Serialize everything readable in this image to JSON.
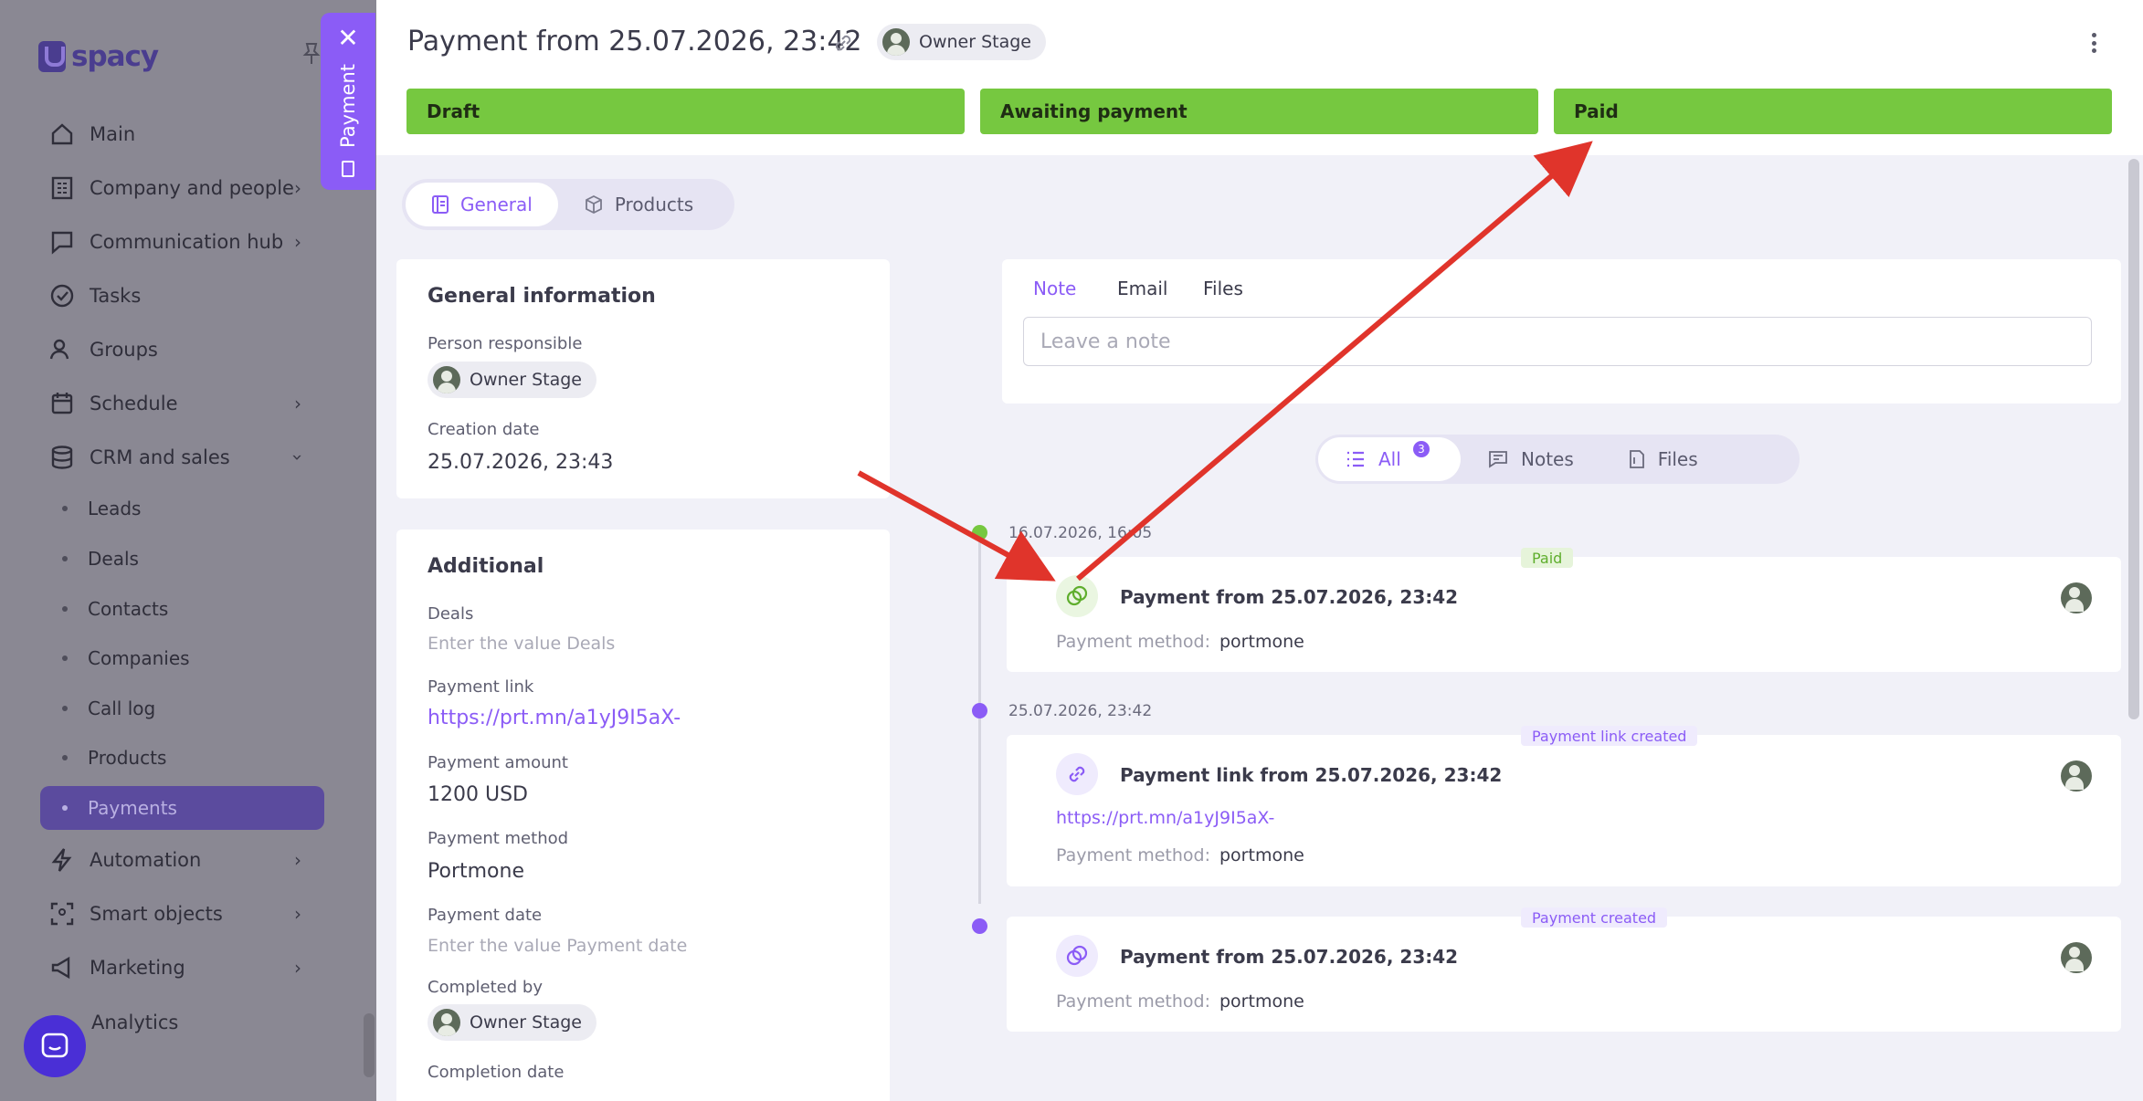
{
  "brand": {
    "name": "spacy"
  },
  "sidebar": {
    "items": [
      {
        "label": "Main",
        "icon": "home-icon"
      },
      {
        "label": "Company and people",
        "icon": "building-icon"
      },
      {
        "label": "Communication hub",
        "icon": "chat-icon"
      },
      {
        "label": "Tasks",
        "icon": "check-circle-icon"
      },
      {
        "label": "Groups",
        "icon": "users-icon"
      },
      {
        "label": "Schedule",
        "icon": "calendar-icon"
      },
      {
        "label": "CRM and sales",
        "icon": "database-icon"
      }
    ],
    "sub_items": [
      "Leads",
      "Deals",
      "Contacts",
      "Companies",
      "Call log",
      "Products",
      "Payments"
    ],
    "bottom_items": [
      {
        "label": "Automation",
        "icon": "lightning-icon"
      },
      {
        "label": "Smart objects",
        "icon": "scan-icon"
      },
      {
        "label": "Marketing",
        "icon": "megaphone-icon"
      },
      {
        "label": "Analytics",
        "icon": "chart-icon"
      }
    ]
  },
  "side_tab": {
    "label": "Payment"
  },
  "header": {
    "title": "Payment from 25.07.2026, 23:42",
    "owner": "Owner Stage",
    "stages": [
      "Draft",
      "Awaiting payment",
      "Paid"
    ],
    "stage_color": "#76c840"
  },
  "tabs": {
    "general": "General",
    "products": "Products"
  },
  "general_info": {
    "heading": "General information",
    "person_label": "Person responsible",
    "person": "Owner Stage",
    "creation_label": "Creation date",
    "creation_value": "25.07.2026, 23:43"
  },
  "additional": {
    "heading": "Additional",
    "deals_label": "Deals",
    "deals_placeholder": "Enter the value Deals",
    "link_label": "Payment link",
    "link_value": "https://prt.mn/a1yJ9I5aX-",
    "amount_label": "Payment amount",
    "amount_value": "1200 USD",
    "method_label": "Payment method",
    "method_value": "Portmone",
    "date_label": "Payment date",
    "date_placeholder": "Enter the value Payment date",
    "completed_label": "Completed by",
    "completed_value": "Owner Stage",
    "completion_label": "Completion date"
  },
  "composer": {
    "tabs": [
      "Note",
      "Email",
      "Files"
    ],
    "placeholder": "Leave a note"
  },
  "filters": {
    "all": "All",
    "all_count": "3",
    "notes": "Notes",
    "files": "Files"
  },
  "timeline": [
    {
      "date": "16.07.2026, 16:05",
      "tag": "Paid",
      "title": "Payment from 25.07.2026, 23:42",
      "link": "",
      "method_label": "Payment method:",
      "method": "portmone",
      "dot_color": "#76c840"
    },
    {
      "date": "25.07.2026, 23:42",
      "tag": "Payment link created",
      "title": "Payment link from 25.07.2026, 23:42",
      "link": "https://prt.mn/a1yJ9I5aX-",
      "method_label": "Payment method:",
      "method": "portmone",
      "dot_color": "#8b5cf6"
    },
    {
      "date": "",
      "tag": "Payment created",
      "title": "Payment from 25.07.2026, 23:42",
      "link": "",
      "method_label": "Payment method:",
      "method": "portmone",
      "dot_color": "#8b5cf6"
    }
  ],
  "colors": {
    "accent": "#8b5cf6",
    "success": "#76c840",
    "annotation_arrow": "#e0342b"
  }
}
